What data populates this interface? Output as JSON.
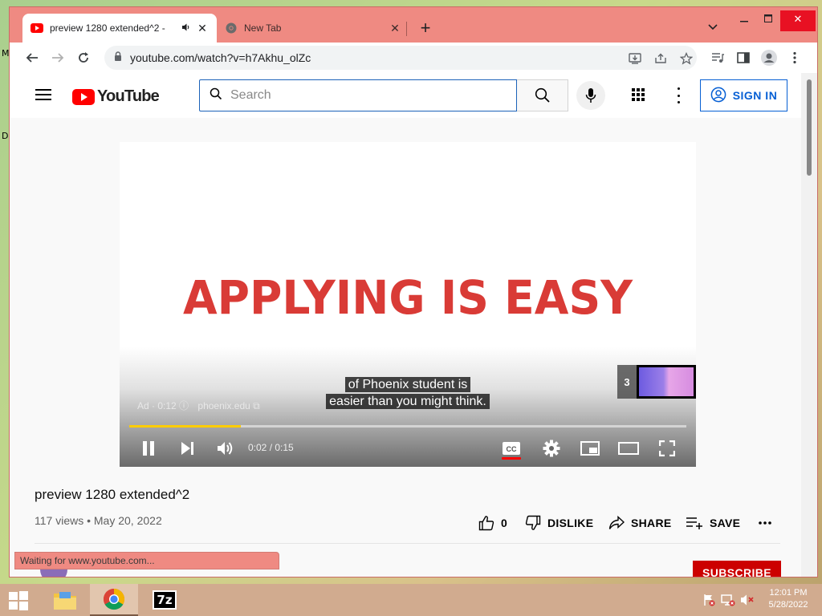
{
  "desktop": {
    "side_labels": [
      "M",
      "D"
    ]
  },
  "browser": {
    "tabs": [
      {
        "title": "preview 1280 extended^2 -",
        "audio_icon": "speaker-icon",
        "active": true
      },
      {
        "title": "New Tab",
        "active": false
      }
    ],
    "new_tab_symbol": "+",
    "url": "youtube.com/watch?v=h7Akhu_olZc",
    "status_text": "Waiting for www.youtube.com..."
  },
  "youtube": {
    "logo_text": "YouTube",
    "search_placeholder": "Search",
    "sign_in_label": "SIGN IN",
    "player": {
      "headline": "APPLYING IS EASY",
      "caption_lines": [
        "of Phoenix student is",
        "easier than you might think."
      ],
      "ad_label": "Ad · 0:12",
      "ad_domain": "phoenix.edu",
      "ad_queue_count": "3",
      "time_display": "0:02 / 0:15",
      "progress_fraction": 0.2,
      "accent_color": "#ffcc00"
    },
    "video": {
      "title": "preview 1280 extended^2",
      "meta": "117 views • May 20, 2022",
      "like_count": "0",
      "dislike_label": "DISLIKE",
      "share_label": "SHARE",
      "save_label": "SAVE"
    },
    "subscribe_label": "SUBSCRIBE"
  },
  "taskbar": {
    "time": "12:01 PM",
    "date": "5/28/2022",
    "seven_zip_label": "7z"
  }
}
